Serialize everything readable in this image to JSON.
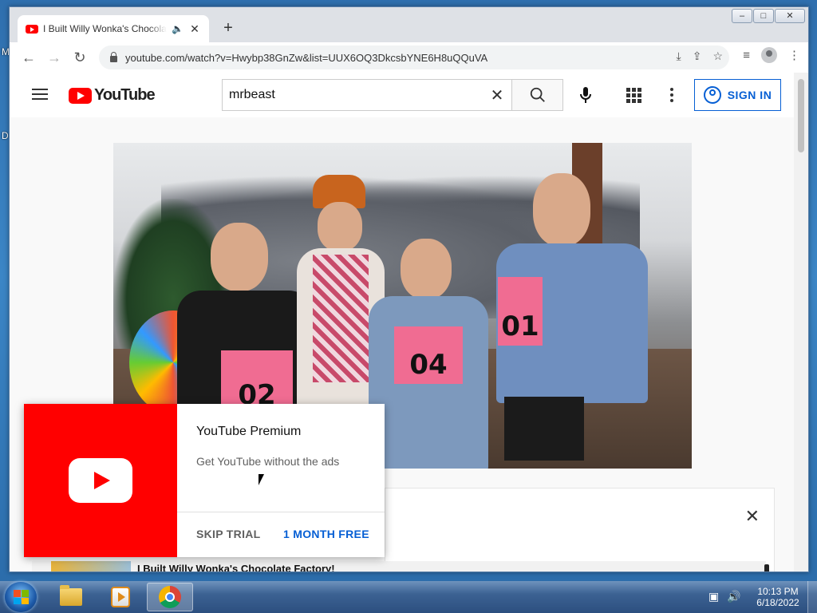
{
  "desktop": {
    "letters": [
      "M",
      "D"
    ]
  },
  "window": {
    "tab_title": "I Built Willy Wonka's Chocolate Factory!",
    "audio_glyph": "🔈",
    "close_glyph": "✕",
    "newtab_glyph": "+",
    "minimize_glyph": "–",
    "maximize_glyph": "□",
    "winclose_glyph": "✕"
  },
  "toolbar": {
    "back_glyph": "←",
    "forward_glyph": "→",
    "reload_glyph": "↻",
    "url": "youtube.com/watch?v=Hwybp38GnZw&list=UUX6OQ3DkcsbYNE6H8uQQuVA"
  },
  "youtube": {
    "logo_text": "YouTube",
    "search_value": "mrbeast",
    "search_clear": "✕",
    "signin_label": "SIGN IN"
  },
  "video": {
    "bib_numbers": [
      "02",
      "04",
      "01"
    ]
  },
  "card": {
    "close_glyph": "✕",
    "list_item_title": "I Built Willy Wonka's Chocolate Factory!"
  },
  "promo": {
    "title": "YouTube Premium",
    "subtitle": "Get YouTube without the ads",
    "skip_label": "SKIP TRIAL",
    "free_label": "1 MONTH FREE"
  },
  "taskbar": {
    "time": "10:13 PM",
    "date": "6/18/2022"
  },
  "colors": {
    "youtube_red": "#ff0000",
    "link_blue": "#065fd4"
  }
}
